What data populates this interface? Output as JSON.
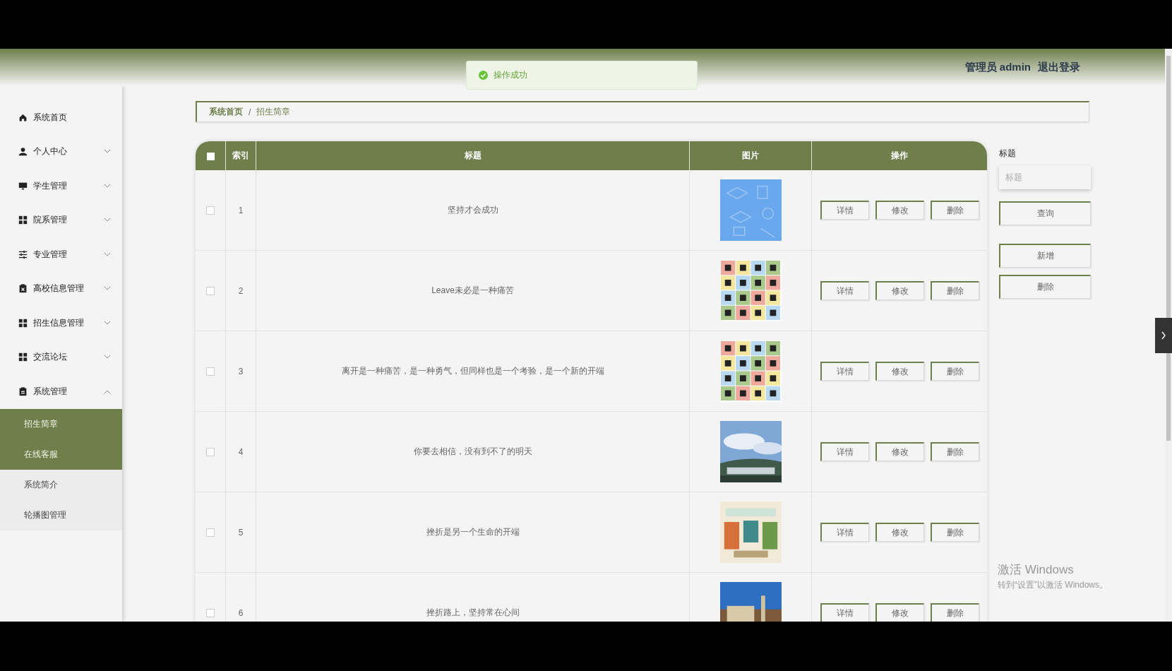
{
  "header": {
    "user": "管理员 admin",
    "logout": "退出登录"
  },
  "toast": {
    "text": "操作成功"
  },
  "sidebar": {
    "items": [
      {
        "label": "系统首页",
        "kind": "link"
      },
      {
        "label": "个人中心",
        "expanded": false,
        "kind": "group"
      },
      {
        "label": "学生管理",
        "expanded": false,
        "kind": "group"
      },
      {
        "label": "院系管理",
        "expanded": false,
        "kind": "group"
      },
      {
        "label": "专业管理",
        "expanded": false,
        "kind": "group"
      },
      {
        "label": "高校信息管理",
        "expanded": false,
        "kind": "group"
      },
      {
        "label": "招生信息管理",
        "expanded": false,
        "kind": "group"
      },
      {
        "label": "交流论坛",
        "expanded": false,
        "kind": "group"
      },
      {
        "label": "系统管理",
        "expanded": true,
        "kind": "group",
        "children": [
          {
            "label": "招生简章",
            "selected": true,
            "hovered": false
          },
          {
            "label": "在线客服",
            "selected": false,
            "hovered": true
          },
          {
            "label": "系统简介",
            "selected": false,
            "hovered": false
          },
          {
            "label": "轮播图管理",
            "selected": false,
            "hovered": false
          }
        ]
      }
    ]
  },
  "breadcrumb": [
    "系统首页",
    "/",
    "招生简章"
  ],
  "table": {
    "all_checked": false,
    "columns": [
      "索引",
      "标题",
      "图片",
      "操作"
    ],
    "rows": [
      {
        "checked": false,
        "index": "1",
        "title": "坚持才会成功",
        "actions": [
          "详情",
          "修改",
          "删除"
        ]
      },
      {
        "checked": false,
        "index": "2",
        "title": "Leave未必是一种痛苦",
        "actions": [
          "详情",
          "修改",
          "删除"
        ]
      },
      {
        "checked": false,
        "index": "3",
        "title": "离开是一种痛苦，是一种勇气，但同样也是一个考验，是一个新的开端",
        "actions": [
          "详情",
          "修改",
          "删除"
        ]
      },
      {
        "checked": false,
        "index": "4",
        "title": "你要去相信，没有到不了的明天",
        "actions": [
          "详情",
          "修改",
          "删除"
        ]
      },
      {
        "checked": false,
        "index": "5",
        "title": "挫折是另一个生命的开端",
        "actions": [
          "详情",
          "修改",
          "删除"
        ]
      },
      {
        "checked": false,
        "index": "6",
        "title": "挫折路上，坚持常在心间",
        "actions": [
          "详情",
          "修改",
          "删除"
        ]
      }
    ]
  },
  "search": {
    "label": "标题",
    "placeholder": "标题",
    "buttons": [
      "查询",
      "新增",
      "删除"
    ]
  },
  "os_notice": {
    "title": "激活 Windows",
    "text": "转到“设置”以激活 Windows。"
  }
}
